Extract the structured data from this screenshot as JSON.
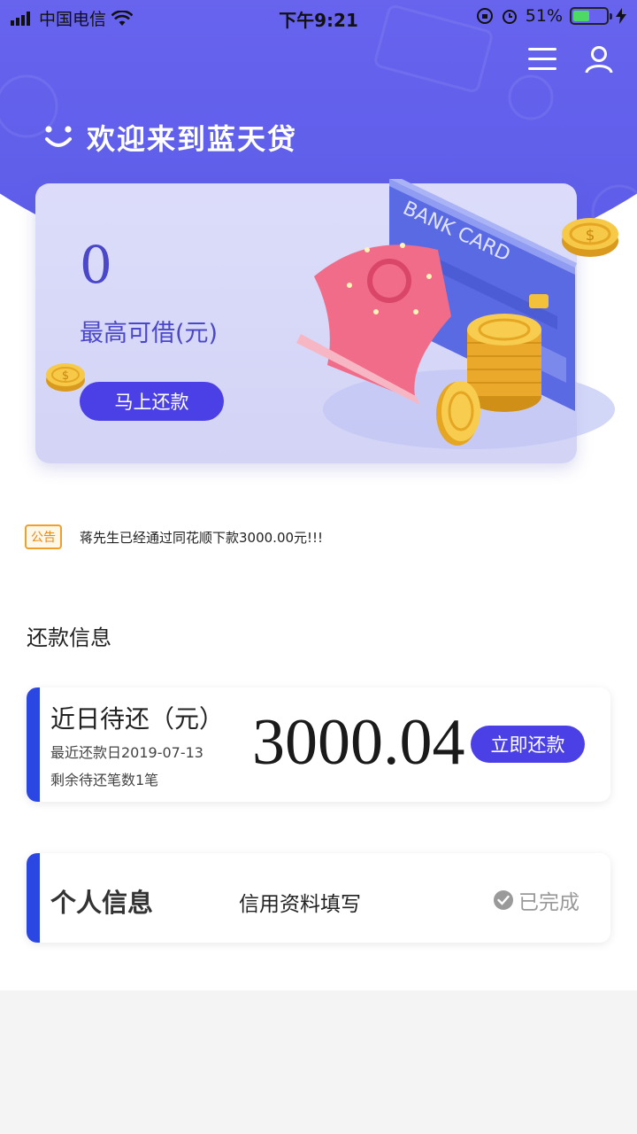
{
  "status_bar": {
    "carrier": "中国电信",
    "time": "下午9:21",
    "battery": "51%",
    "battery_level": 0.51
  },
  "header": {
    "menu_icon": "menu-icon",
    "user_icon": "user-icon",
    "welcome_text": "欢迎来到蓝天贷"
  },
  "credit_card": {
    "amount": "0",
    "caption": "最高可借(元)",
    "button_label": "马上还款",
    "illustration_text": "BANK CARD"
  },
  "notice": {
    "badge": "公告",
    "text": "蒋先生已经通过同花顺下款3000.00元!!!"
  },
  "repayment_section": {
    "title": "还款信息",
    "card": {
      "title": "近日待还（元）",
      "date": "最近还款日2019-07-13",
      "count": "剩余待还笔数1笔",
      "amount": "3000.04",
      "button_label": "立即还款"
    }
  },
  "personal_section": {
    "title": "个人信息",
    "subtitle": "信用资料填写",
    "status": "已完成"
  },
  "colors": {
    "primary": "#4b40e6",
    "accent_bar": "#2b47e3",
    "header_gradient_top": "#8a7cf6",
    "header_gradient_bottom": "#5a5ce8",
    "notice": "#f0a02a",
    "battery": "#4cd964"
  }
}
